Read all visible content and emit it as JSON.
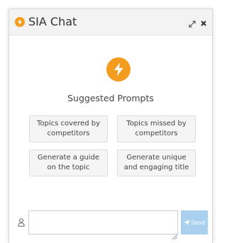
{
  "header": {
    "title": "SIA Chat",
    "logo_icon": "bolt-icon",
    "expand_icon": "expand-arrows-icon",
    "close_icon": "close-icon"
  },
  "main": {
    "hero_icon": "bolt-icon",
    "suggested_heading": "Suggested Prompts",
    "prompts": [
      {
        "label": "Topics covered by competitors"
      },
      {
        "label": "Topics missed by competitors"
      },
      {
        "label": "Generate a guide on the topic"
      },
      {
        "label": "Generate unique and engaging title"
      }
    ]
  },
  "composer": {
    "user_icon": "user-icon",
    "input_value": "",
    "input_placeholder": "",
    "send_label": "Send",
    "send_icon": "paper-plane-icon"
  },
  "colors": {
    "accent": "#f39c1f",
    "send_button": "#a9d0ef",
    "header_bg": "#f3f3f3"
  }
}
